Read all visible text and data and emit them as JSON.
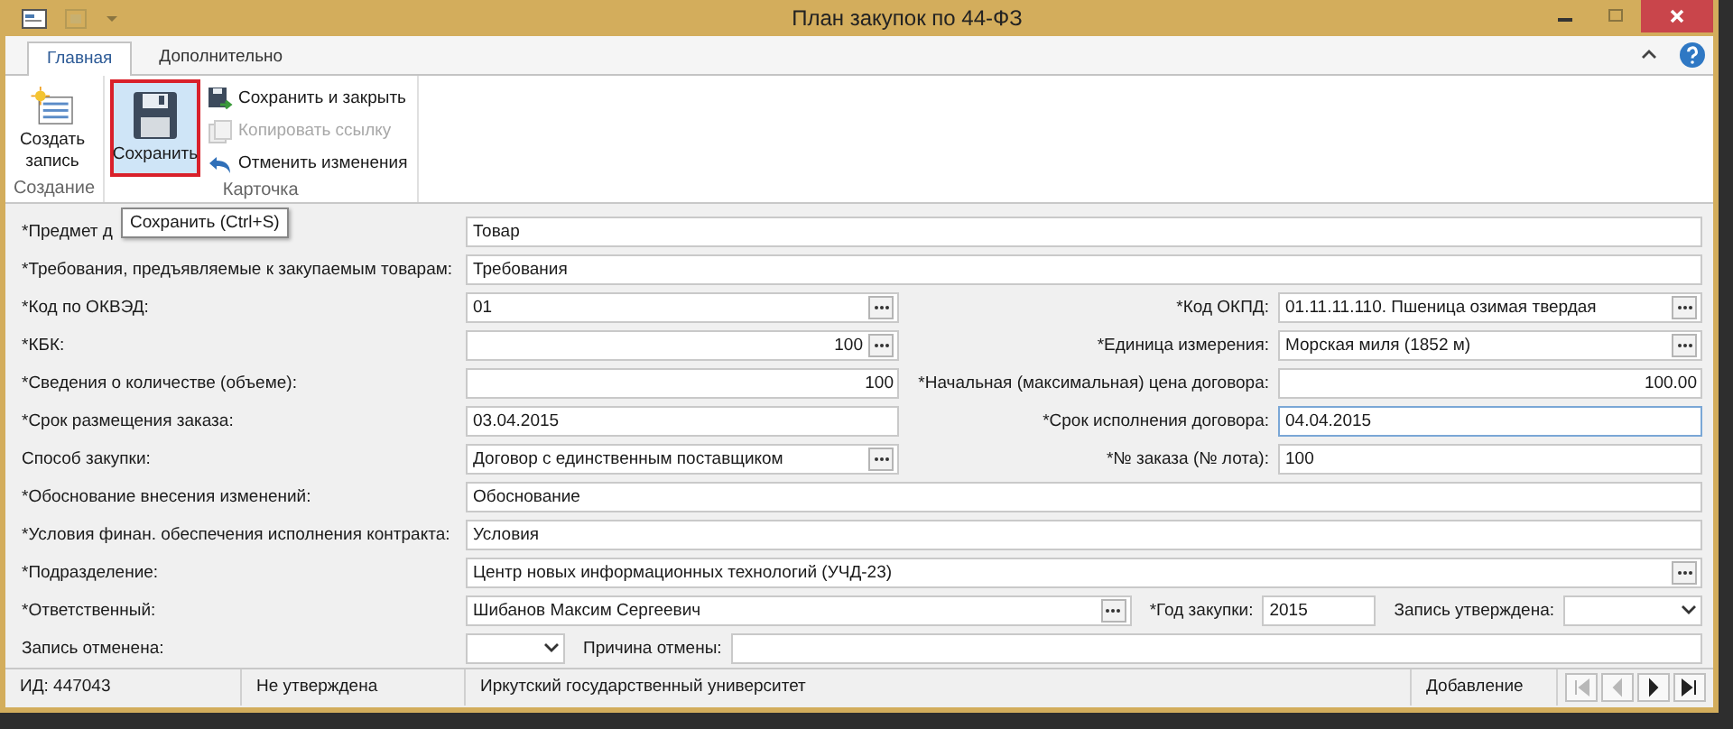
{
  "window": {
    "title": "План закупок по 44-ФЗ"
  },
  "tabs": [
    {
      "label": "Главная",
      "selected": true
    },
    {
      "label": "Дополнительно",
      "selected": false
    }
  ],
  "ribbon": {
    "groups": [
      {
        "label": "Создание",
        "buttons": [
          {
            "label": "Создать запись",
            "kind": "large",
            "hovered": false,
            "disabled": false
          }
        ]
      },
      {
        "label": "Карточка",
        "buttons": [
          {
            "label": "Сохранить",
            "kind": "large",
            "hovered": true,
            "disabled": false
          },
          {
            "label": "Сохранить и закрыть",
            "kind": "small",
            "hovered": false,
            "disabled": false
          },
          {
            "label": "Копировать ссылку",
            "kind": "small",
            "hovered": false,
            "disabled": true
          },
          {
            "label": "Отменить изменения",
            "kind": "small",
            "hovered": false,
            "disabled": false
          }
        ]
      }
    ]
  },
  "tooltip": {
    "text": "Сохранить (Ctrl+S)"
  },
  "form": {
    "rows": [
      {
        "kind": "full",
        "label": "*Предмет д",
        "field": {
          "kind": "text",
          "value": "Товар"
        }
      },
      {
        "kind": "full",
        "label": "*Требования, предъявляемые к закупаемым товарам:",
        "field": {
          "kind": "text",
          "value": "Требования"
        }
      },
      {
        "kind": "pair",
        "label": "*Код по ОКВЭД:",
        "field": {
          "kind": "browse",
          "value": "01"
        },
        "label_2": "*Код ОКПД:",
        "field_2": {
          "kind": "browse",
          "value": "01.11.11.110. Пшеница озимая твердая"
        }
      },
      {
        "kind": "pair",
        "label": "*КБК:",
        "field": {
          "kind": "browse",
          "value": "100",
          "numeric": true
        },
        "label_2": "*Единица измерения:",
        "field_2": {
          "kind": "browse",
          "value": "Морская миля (1852 м)"
        }
      },
      {
        "kind": "pair",
        "label": "*Сведения о количестве (объеме):",
        "field": {
          "kind": "text",
          "value": "100",
          "numeric": true
        },
        "label_2": "*Начальная (максимальная) цена договора:",
        "field_2": {
          "kind": "text",
          "value": "100.00",
          "numeric": true
        }
      },
      {
        "kind": "pair",
        "label": "*Срок размещения заказа:",
        "field": {
          "kind": "text",
          "value": "03.04.2015"
        },
        "label_2": "*Срок исполнения договора:",
        "field_2": {
          "kind": "text",
          "value": "04.04.2015",
          "focused": true
        }
      },
      {
        "kind": "pair",
        "label": "Способ закупки:",
        "field": {
          "kind": "browse",
          "value": "Договор с единственным поставщиком"
        },
        "label_2": "*№ заказа (№ лота):",
        "field_2": {
          "kind": "text",
          "value": "100"
        }
      },
      {
        "kind": "full",
        "label": "*Обоснование внесения изменений:",
        "field": {
          "kind": "text",
          "value": "Обоснование"
        }
      },
      {
        "kind": "full",
        "label": "*Условия финан. обеспечения исполнения контракта:",
        "field": {
          "kind": "text",
          "value": "Условия"
        }
      },
      {
        "kind": "full",
        "label": "*Подразделение:",
        "field": {
          "kind": "browse",
          "value": "Центр новых информационных технологий (УЧД-23)"
        }
      },
      {
        "kind": "responsible",
        "label": "*Ответственный:",
        "field": {
          "kind": "browse",
          "value": "Шибанов Максим Сергеевич"
        },
        "label_2": "*Год закупки:",
        "field_2": {
          "kind": "text",
          "value": "2015"
        },
        "label_3": "Запись утверждена:",
        "field_3": {
          "kind": "combo"
        }
      },
      {
        "kind": "cancel",
        "label": "Запись отменена:",
        "field": {
          "kind": "combo"
        },
        "label_2": "Причина отмены:",
        "field_2": {
          "kind": "text"
        }
      }
    ]
  },
  "status_bar": {
    "cells": [
      "ИД: 447043",
      "Не утверждена",
      "Иркутский государственный университет",
      "Добавление"
    ],
    "nav": [
      {
        "kind": "first",
        "disabled": true
      },
      {
        "kind": "prev",
        "disabled": true
      },
      {
        "kind": "next",
        "disabled": false
      },
      {
        "kind": "last",
        "disabled": false
      }
    ]
  }
}
